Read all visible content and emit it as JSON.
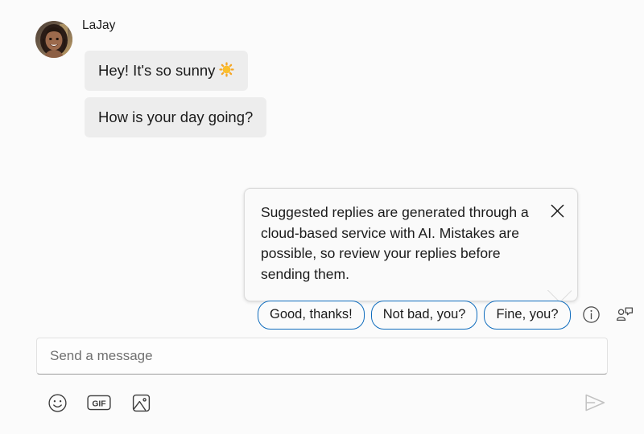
{
  "conversation": {
    "sender": {
      "name": "LaJay",
      "avatar_alt": "user-avatar-photo"
    },
    "messages": [
      {
        "text": "Hey! It's so sunny",
        "emoji": "sun-emoji"
      },
      {
        "text": "How is your day going?",
        "emoji": null
      }
    ]
  },
  "tooltip": {
    "text": "Suggested replies are generated through a cloud-based service with AI. Mistakes are possible, so review your replies before sending them.",
    "close_icon": "close-icon"
  },
  "suggestions": {
    "chips": [
      {
        "label": "Good, thanks!"
      },
      {
        "label": "Not bad, you?"
      },
      {
        "label": "Fine, you?"
      }
    ],
    "info_icon": "info-circle-icon",
    "settings_icon": "suggested-replies-icon"
  },
  "composer": {
    "placeholder": "Send a message",
    "value": "",
    "tools": [
      {
        "icon": "emoji-smiley-icon"
      },
      {
        "icon": "gif-icon",
        "label": "GIF"
      },
      {
        "icon": "image-icon"
      }
    ],
    "send_icon": "send-icon"
  },
  "colors": {
    "background": "#fbfbfb",
    "bubble": "#ededed",
    "chip_border": "#0f6cbd",
    "text": "#1b1b1b",
    "placeholder": "#707070",
    "icon": "#3b3b3b",
    "send_icon": "#c4c4c4",
    "tooltip_bg": "#fafafa",
    "tooltip_border": "#dcdcdc"
  }
}
